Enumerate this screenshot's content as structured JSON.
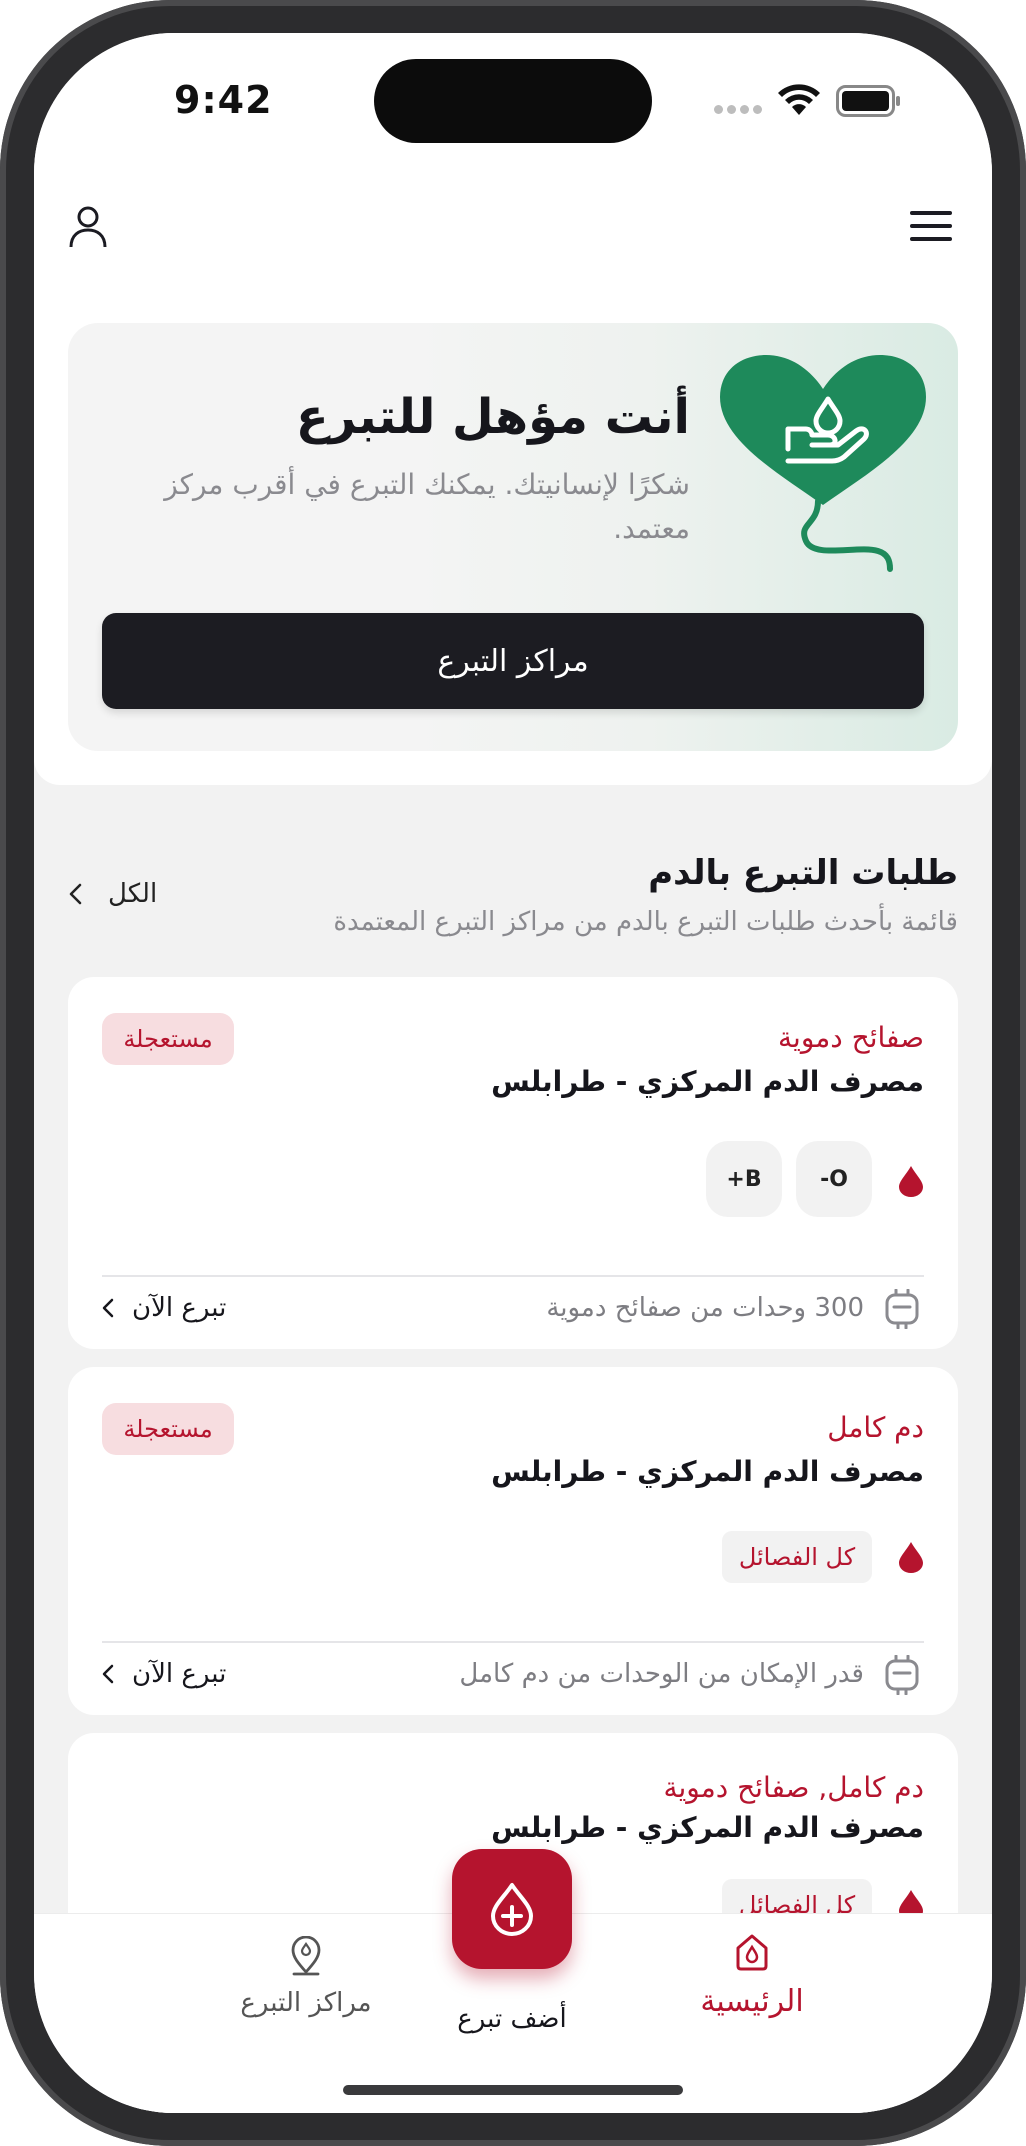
{
  "status_bar": {
    "time": "9:42"
  },
  "colors": {
    "brand_red": "#b5142e",
    "brand_green": "#1e8a5b",
    "dark_button": "#1c1c22"
  },
  "header": {
    "profile_icon": "person-icon",
    "menu_icon": "hamburger-menu-icon"
  },
  "hero": {
    "title": "أنت مؤهل للتبرع",
    "subtitle": "شكرًا لإنسانيتك. يمكنك التبرع في أقرب مركز معتمد.",
    "button_label": "مراكز التبرع",
    "illustration": "heart-with-hand-drop-icon"
  },
  "requests_section": {
    "title": "طلبات التبرع بالدم",
    "subtitle": "قائمة بأحدث طلبات التبرع بالدم من مراكز التبرع المعتمدة",
    "see_all_label": "الكل"
  },
  "requests": [
    {
      "type": "صفائح دموية",
      "bank": "مصرف الدم المركزي - طرابلس",
      "badge": "مستعجلة",
      "blood_groups": [
        "-O",
        "+B"
      ],
      "units": "300 وحدات من صفائح دموية",
      "action": "تبرع الآن"
    },
    {
      "type": "دم كامل",
      "bank": "مصرف الدم المركزي - طرابلس",
      "badge": "مستعجلة",
      "blood_groups_label": "كل الفصائل",
      "units": "قدر الإمكان من الوحدات من دم كامل",
      "action": "تبرع الآن"
    },
    {
      "type": "دم كامل,  صفائح دموية",
      "bank": "مصرف الدم المركزي - طرابلس",
      "blood_groups_label": "كل الفصائل"
    }
  ],
  "bottom_nav": {
    "home_label": "الرئيسية",
    "add_label": "أضف تبرع",
    "centers_label": "مراكز التبرع",
    "active": "home"
  }
}
